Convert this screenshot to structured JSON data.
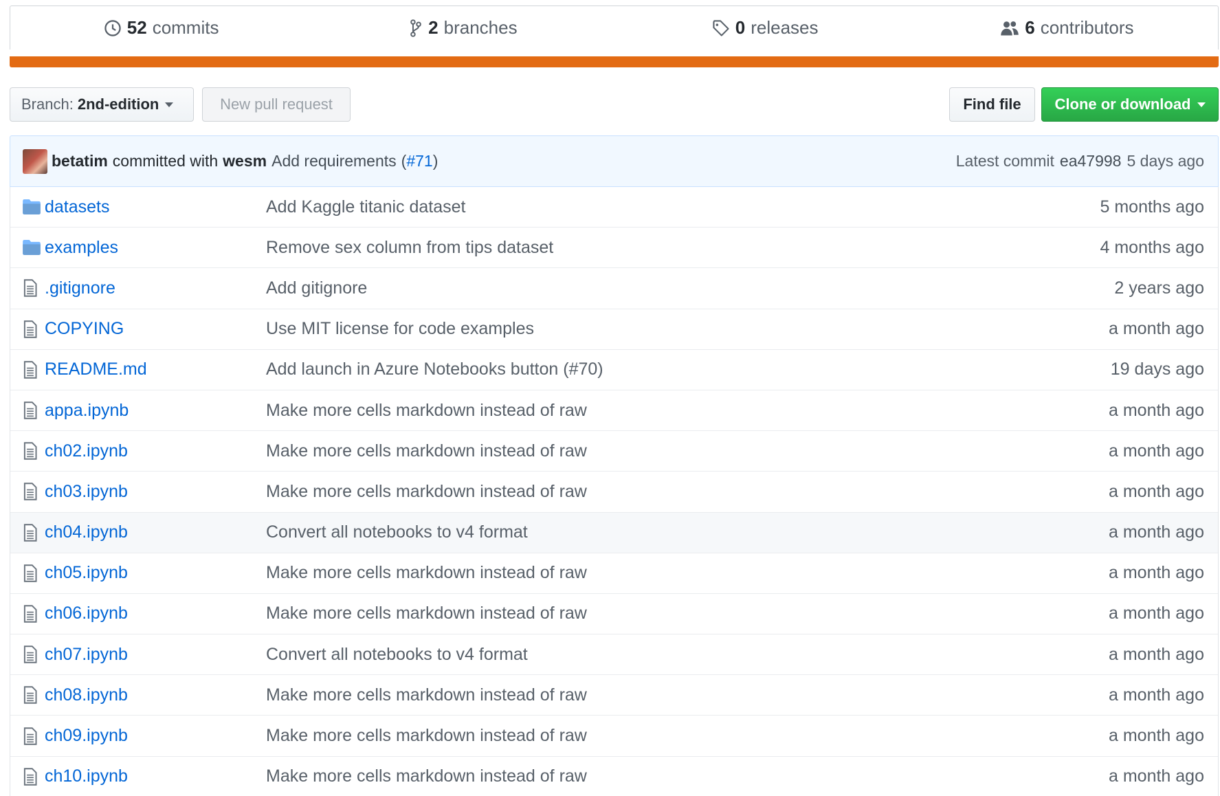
{
  "summary": {
    "commits": {
      "count": "52",
      "label": "commits",
      "icon": "history-icon"
    },
    "branches": {
      "count": "2",
      "label": "branches",
      "icon": "branch-icon"
    },
    "releases": {
      "count": "0",
      "label": "releases",
      "icon": "tag-icon"
    },
    "contributors": {
      "count": "6",
      "label": "contributors",
      "icon": "people-icon"
    }
  },
  "colors": {
    "language_bar": "#e36b13",
    "clone_button": "#28a745",
    "link": "#0366d6"
  },
  "toolbar": {
    "branch_prefix": "Branch:",
    "branch_name": "2nd-edition",
    "new_pull_request": "New pull request",
    "find_file": "Find file",
    "clone_or_download": "Clone or download"
  },
  "latest_commit": {
    "author": "betatim",
    "committed_with": "committed with",
    "committer": "wesm",
    "message": "Add requirements",
    "pr_open": "(",
    "pr_link": "#71",
    "pr_close": ")",
    "label": "Latest commit",
    "sha": "ea47998",
    "age": "5 days ago"
  },
  "files": [
    {
      "type": "dir",
      "name": "datasets",
      "message": "Add Kaggle titanic dataset",
      "age": "5 months ago"
    },
    {
      "type": "dir",
      "name": "examples",
      "message": "Remove sex column from tips dataset",
      "age": "4 months ago"
    },
    {
      "type": "file",
      "name": ".gitignore",
      "message": "Add gitignore",
      "age": "2 years ago"
    },
    {
      "type": "file",
      "name": "COPYING",
      "message": "Use MIT license for code examples",
      "age": "a month ago"
    },
    {
      "type": "file",
      "name": "README.md",
      "message": "Add launch in Azure Notebooks button (#70)",
      "age": "19 days ago"
    },
    {
      "type": "file",
      "name": "appa.ipynb",
      "message": "Make more cells markdown instead of raw",
      "age": "a month ago"
    },
    {
      "type": "file",
      "name": "ch02.ipynb",
      "message": "Make more cells markdown instead of raw",
      "age": "a month ago"
    },
    {
      "type": "file",
      "name": "ch03.ipynb",
      "message": "Make more cells markdown instead of raw",
      "age": "a month ago"
    },
    {
      "type": "file",
      "name": "ch04.ipynb",
      "message": "Convert all notebooks to v4 format",
      "age": "a month ago"
    },
    {
      "type": "file",
      "name": "ch05.ipynb",
      "message": "Make more cells markdown instead of raw",
      "age": "a month ago"
    },
    {
      "type": "file",
      "name": "ch06.ipynb",
      "message": "Make more cells markdown instead of raw",
      "age": "a month ago"
    },
    {
      "type": "file",
      "name": "ch07.ipynb",
      "message": "Convert all notebooks to v4 format",
      "age": "a month ago"
    },
    {
      "type": "file",
      "name": "ch08.ipynb",
      "message": "Make more cells markdown instead of raw",
      "age": "a month ago"
    },
    {
      "type": "file",
      "name": "ch09.ipynb",
      "message": "Make more cells markdown instead of raw",
      "age": "a month ago"
    },
    {
      "type": "file",
      "name": "ch10.ipynb",
      "message": "Make more cells markdown instead of raw",
      "age": "a month ago"
    }
  ]
}
